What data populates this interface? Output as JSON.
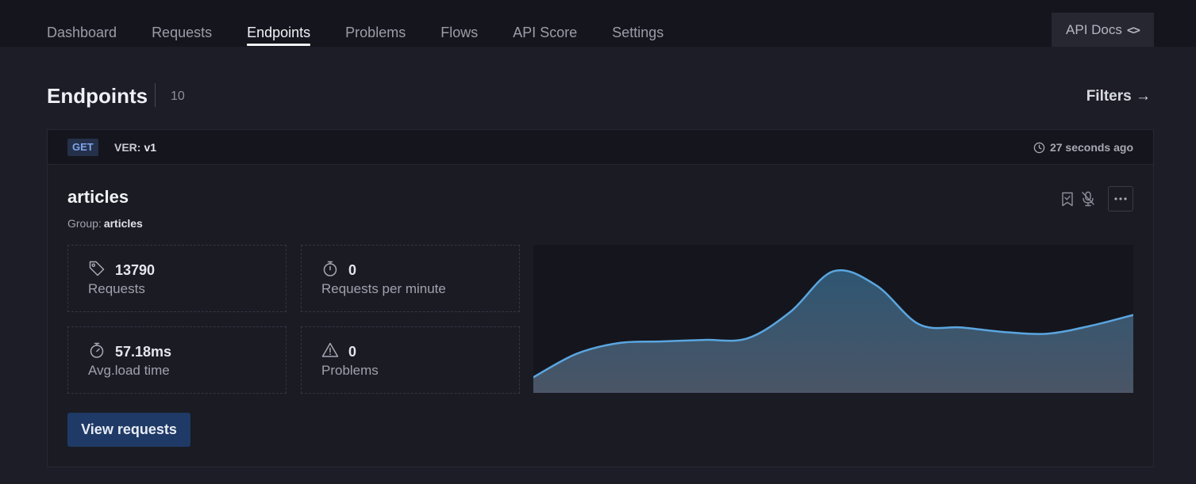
{
  "nav": {
    "tabs": [
      {
        "label": "Dashboard",
        "active": false
      },
      {
        "label": "Requests",
        "active": false
      },
      {
        "label": "Endpoints",
        "active": true
      },
      {
        "label": "Problems",
        "active": false
      },
      {
        "label": "Flows",
        "active": false
      },
      {
        "label": "API Score",
        "active": false
      },
      {
        "label": "Settings",
        "active": false
      }
    ],
    "api_docs_label": "API Docs",
    "api_docs_icon": "code-icon"
  },
  "header": {
    "title": "Endpoints",
    "count": "10",
    "filters_label": "Filters →"
  },
  "endpoint": {
    "method": "GET",
    "version_label": "VER:",
    "version": "v1",
    "time_ago": "27 seconds ago",
    "name": "articles",
    "group_label": "Group:",
    "group": "articles",
    "stats": {
      "requests": {
        "value": "13790",
        "label": "Requests",
        "icon": "tag-icon"
      },
      "rpm": {
        "value": "0",
        "label": "Requests per minute",
        "icon": "stopwatch-icon"
      },
      "load": {
        "value": "57.18ms",
        "label": "Avg.load time",
        "icon": "stopwatch-icon"
      },
      "problems": {
        "value": "0",
        "label": "Problems",
        "icon": "warning-icon"
      }
    },
    "view_button": "View requests"
  },
  "colors": {
    "accent": "#1f3a66",
    "chart_line": "#5aa6e0",
    "chart_fill_top": "#2f5673",
    "chart_fill_bottom": "#4a5566"
  },
  "chart_data": {
    "type": "area",
    "values": [
      1.0,
      2.5,
      3.2,
      3.3,
      3.4,
      3.5,
      5.2,
      7.8,
      6.9,
      4.4,
      4.2,
      3.9,
      3.8,
      4.3,
      5.0
    ]
  }
}
